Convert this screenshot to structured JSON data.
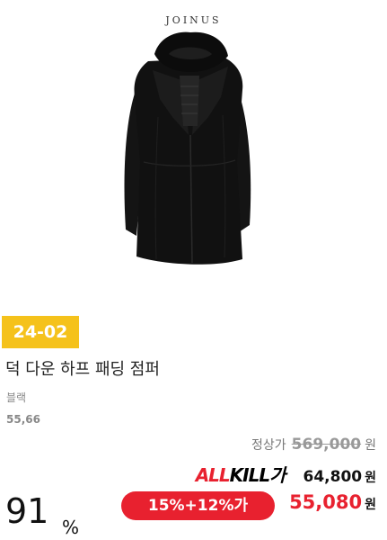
{
  "product": {
    "brand": "JOINUS",
    "season_badge": "24-02",
    "name": "덕 다운 하프 패딩 점퍼",
    "color": "블랙",
    "sizes": "55,66",
    "original_price_label": "정상가",
    "original_price": "569,000",
    "currency": "원",
    "allkill_logo": {
      "part1": "ALL",
      "part2": "KILL",
      "part3": "가"
    },
    "allkill_price": "64,800",
    "discount_rate": "91",
    "percent": "%",
    "coupon_text": "15%+12%가",
    "final_price": "55,080"
  },
  "colors": {
    "badge_yellow": "#f5c21b",
    "accent_red": "#e8212f",
    "coat_black": "#111111"
  },
  "icons": {
    "product_image": "black-down-coat-image"
  }
}
